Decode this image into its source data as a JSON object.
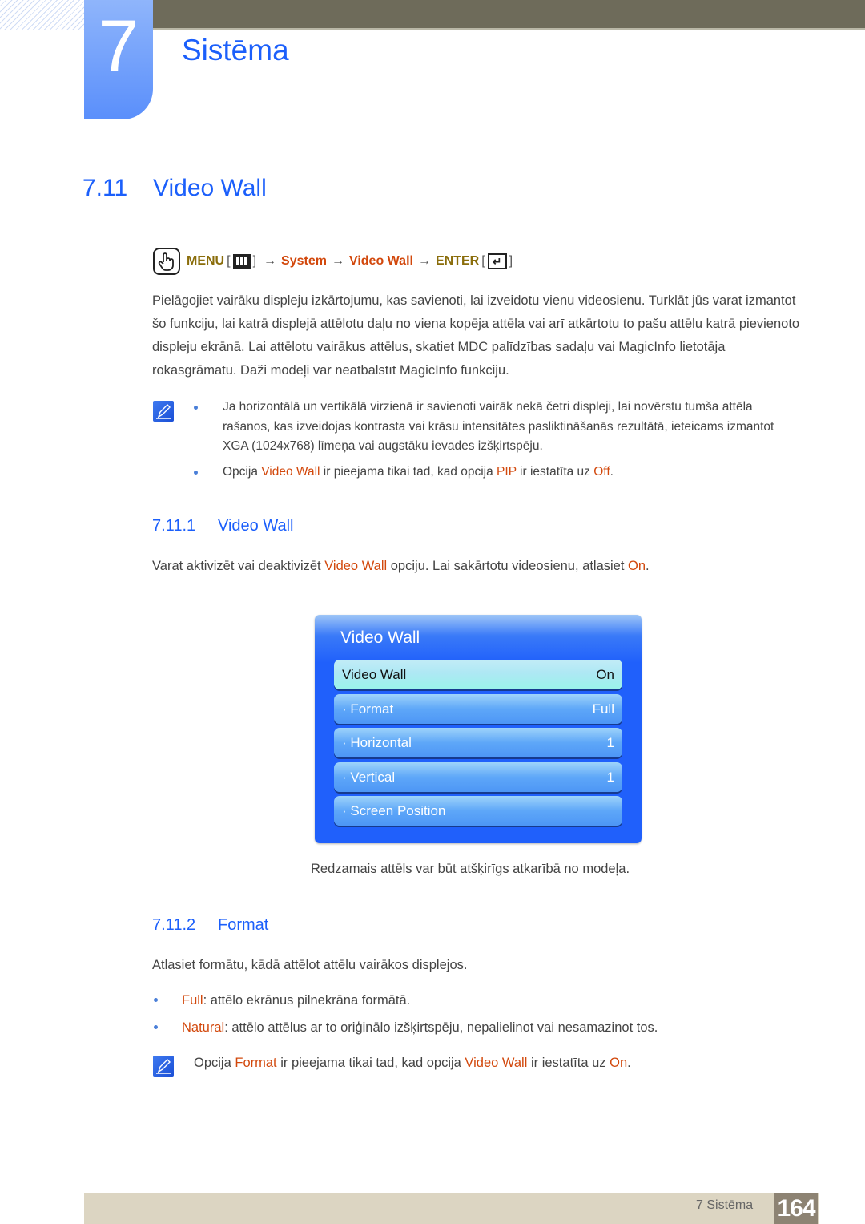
{
  "chapter": {
    "number": "7",
    "title": "Sistēma"
  },
  "section": {
    "number": "7.11",
    "title": "Video Wall"
  },
  "menu_path": {
    "menu": "MENU",
    "arrow": "→",
    "system": "System",
    "video_wall": "Video Wall",
    "enter": "ENTER",
    "enter_glyph": "↵",
    "bracket_open": "[",
    "bracket_close": "]"
  },
  "intro": "Pielāgojiet vairāku displeju izkārtojumu, kas savienoti, lai izveidotu vienu videosienu. Turklāt jūs varat izmantot šo funkciju, lai katrā displejā attēlotu daļu no viena kopēja attēla vai arī atkārtotu to pašu attēlu katrā pievienoto displeju ekrānā. Lai attēlotu vairākus attēlus, skatiet MDC palīdzības sadaļu vai MagicInfo lietotāja rokasgrāmatu. Daži modeļi var neatbalstīt MagicInfo funkciju.",
  "notes1": {
    "item1": "Ja horizontālā un vertikālā virzienā ir savienoti vairāk nekā četri displeji, lai novērstu tumša attēla rašanos, kas izveidojas kontrasta vai krāsu intensitātes pasliktināšanās rezultātā, ieteicams izmantot XGA (1024x768) līmeņa vai augstāku ievades izšķirtspēju.",
    "item2": {
      "pre": "Opcija ",
      "hl1": "Video Wall",
      "mid1": " ir pieejama tikai tad, kad opcija ",
      "hl2": "PIP",
      "mid2": " ir iestatīta uz ",
      "hl3": "Off",
      "post": "."
    }
  },
  "sub1": {
    "number": "7.11.1",
    "title": "Video Wall",
    "text": {
      "pre": "Varat aktivizēt vai deaktivizēt ",
      "hl1": "Video Wall",
      "mid": " opciju. Lai sakārtotu videosienu, atlasiet ",
      "hl2": "On",
      "post": "."
    }
  },
  "osd": {
    "title": "Video Wall",
    "items": [
      {
        "label": "Video Wall",
        "value": "On"
      },
      {
        "label": "· Format",
        "value": "Full"
      },
      {
        "label": "· Horizontal",
        "value": "1"
      },
      {
        "label": "· Vertical",
        "value": "1"
      },
      {
        "label": "· Screen Position",
        "value": ""
      }
    ]
  },
  "caption": "Redzamais attēls var būt atšķirīgs atkarībā no modeļa.",
  "sub2": {
    "number": "7.11.2",
    "title": "Format",
    "text": "Atlasiet formātu, kādā attēlot attēlu vairākos displejos.",
    "bullets": [
      {
        "term": "Full",
        "desc": ": attēlo ekrānus pilnekrāna formātā."
      },
      {
        "term": "Natural",
        "desc": ": attēlo attēlus ar to oriģinālo izšķirtspēju, nepalielinot vai nesamazinot tos."
      }
    ],
    "note": {
      "pre": "Opcija ",
      "hl1": "Format",
      "mid1": " ir pieejama tikai tad, kad opcija ",
      "hl2": "Video Wall",
      "mid2": " ir iestatīta uz ",
      "hl3": "On",
      "post": "."
    }
  },
  "footer": {
    "label": "7 Sistēma",
    "page": "164"
  }
}
